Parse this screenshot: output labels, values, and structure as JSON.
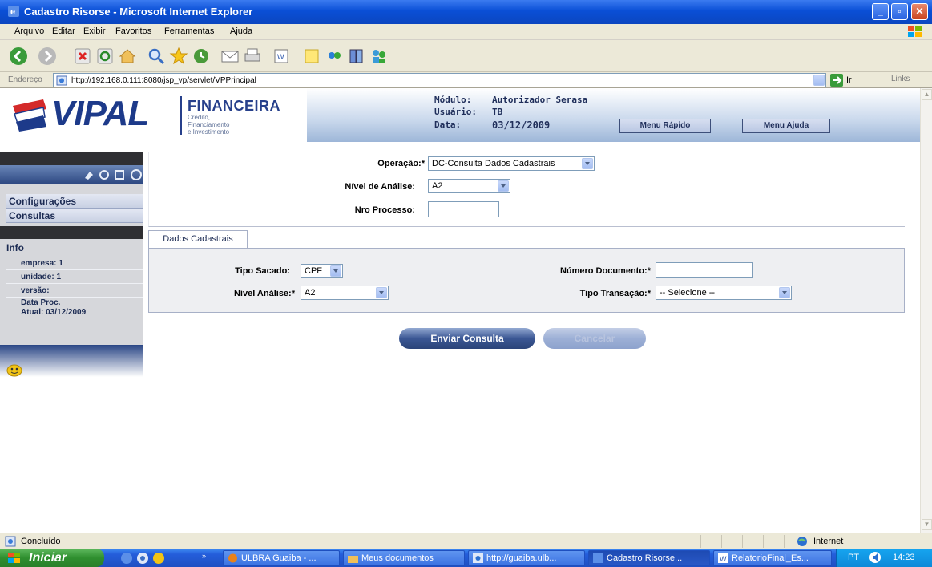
{
  "window": {
    "title": "Cadastro Risorse - Microsoft Internet Explorer"
  },
  "menubar": {
    "items": [
      "Arquivo",
      "Editar",
      "Exibir",
      "Favoritos",
      "Ferramentas",
      "Ajuda"
    ]
  },
  "addressbar": {
    "label": "Endereço",
    "url": "http://192.168.0.111:8080/jsp_vp/servlet/VPPrincipal",
    "go": "Ir",
    "links": "Links"
  },
  "banner": {
    "brand": "VIPAL",
    "fin_title": "FINANCEIRA",
    "fin_sub": [
      "Crédito,",
      "Financiamento",
      "e Investimento"
    ],
    "modulo_label": "Módulo:",
    "modulo_value": "Autorizador Serasa",
    "usuario_label": "Usuário:",
    "usuario_value": "TB",
    "data_label": "Data:",
    "data_value": "03/12/2009",
    "menu_rapido": "Menu Rápido",
    "menu_ajuda": "Menu Ajuda"
  },
  "sidebar": {
    "menu": [
      "Configurações",
      "Consultas"
    ],
    "info_title": "Info",
    "info_rows": [
      "empresa: 1",
      "unidade: 1",
      "versão:",
      "Data Proc.",
      "Atual: 03/12/2009"
    ]
  },
  "form": {
    "operacao_label": "Operação:*",
    "operacao_value": "DC-Consulta Dados Cadastrais",
    "nivel_label": "Nível de Análise:",
    "nivel_value": "A2",
    "processo_label": "Nro Processo:",
    "processo_value": ""
  },
  "tab": {
    "label": "Dados Cadastrais",
    "tipo_sacado_label": "Tipo Sacado:",
    "tipo_sacado_value": "CPF",
    "nivel_analise_label": "Nível Análise:*",
    "nivel_analise_value": "A2",
    "numero_doc_label": "Número Documento:*",
    "numero_doc_value": "",
    "tipo_transacao_label": "Tipo Transação:*",
    "tipo_transacao_value": "-- Selecione --"
  },
  "buttons": {
    "enviar": "Enviar Consulta",
    "cancelar": "Cancelar"
  },
  "statusbar": {
    "status": "Concluído",
    "zone": "Internet"
  },
  "taskbar": {
    "start": "Iniciar",
    "tasks": [
      "ULBRA Guaiba - ...",
      "Meus documentos",
      "http://guaiba.ulb...",
      "Cadastro Risorse...",
      "RelatorioFinal_Es..."
    ],
    "lang": "PT",
    "clock": "14:23"
  }
}
